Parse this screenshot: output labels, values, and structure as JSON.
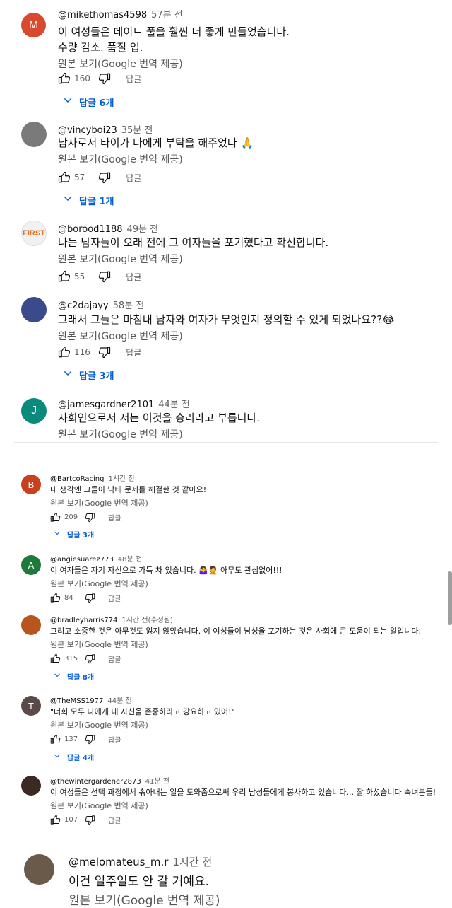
{
  "translate_label": "원본 보기(Google 번역 제공)",
  "reply_label": "답글",
  "comments": [
    {
      "handle": "@mikethomas4598",
      "time": "57분 전",
      "lines": [
        "이 여성들은 데이트 풀을 훨씬 더 좋게 만들었습니다.",
        "수량 감소. 품질 업."
      ],
      "likes": "160",
      "replies": "답글 6개",
      "avatar": "M",
      "avatar_color": "#d84a2f"
    },
    {
      "handle": "@vincyboi23",
      "time": "35분 전",
      "lines": [
        "남자로서 타이가 나에게 부탁을 해주었다 🙏"
      ],
      "likes": "57",
      "replies": "답글 1개",
      "avatar": "",
      "avatar_color": "#7a7a7a"
    },
    {
      "handle": "@borood1188",
      "time": "49분 전",
      "lines": [
        "나는 남자들이 오래 전에 그 여자들을 포기했다고 확신합니다."
      ],
      "likes": "55",
      "replies": "",
      "avatar": "FIRST",
      "avatar_color": "#f1f1f1"
    },
    {
      "handle": "@c2dajayy",
      "time": "58분 전",
      "lines": [
        "그래서 그들은 마침내 남자와 여자가 무엇인지 정의할 수 있게 되었나요??😂"
      ],
      "likes": "116",
      "replies": "답글 3개",
      "avatar": "",
      "avatar_color": "#3a4a8a"
    },
    {
      "handle": "@jamesgardner2101",
      "time": "44분 전",
      "lines": [
        "사회인으로서 저는 이것을 승리라고 부릅니다."
      ],
      "likes": "",
      "replies": "",
      "avatar": "J",
      "avatar_color": "#0a8a7a"
    },
    {
      "handle": "@BartcoRacing",
      "time": "1시간 전",
      "lines": [
        "내 생각엔 그들이 낙태 문제를 해결한 것 같아요!"
      ],
      "likes": "209",
      "replies": "답글 3개",
      "avatar": "B",
      "avatar_color": "#c8401f"
    },
    {
      "handle": "@angiesuarez773",
      "time": "48분 전",
      "lines": [
        "이 여자들은 자기 자신으로 가득 차 있습니다. 🤷‍♀️🤦 아무도 관심없어!!!"
      ],
      "likes": "84",
      "replies": "",
      "avatar": "A",
      "avatar_color": "#1e7a3a"
    },
    {
      "handle": "@bradleyharris774",
      "time": "1시간 전(수정됨)",
      "lines": [
        "그리고 소중한 것은 아무것도 잃지 않았습니다. 이 여성들이 남성을 포기하는 것은 사회에 큰 도움이 되는 일입니다."
      ],
      "likes": "315",
      "replies": "답글 8개",
      "avatar": "",
      "avatar_color": "#b8551e"
    },
    {
      "handle": "@TheMSS1977",
      "time": "44분 전",
      "lines": [
        "\"너희 모두 나에게 내 자신을 존중하라고 강요하고 있어!\""
      ],
      "likes": "137",
      "replies": "답글 4개",
      "avatar": "T",
      "avatar_color": "#5a4a4a"
    },
    {
      "handle": "@thewintergardener2873",
      "time": "41분 전",
      "lines": [
        "이 여성들은 선택 과정에서 솎아내는 일을 도와줌으로써 우리 남성들에게 봉사하고 있습니다... 잘 하셨습니다 숙녀분들!"
      ],
      "likes": "107",
      "replies": "",
      "avatar": "",
      "avatar_color": "#3a2a22"
    },
    {
      "handle": "@melomateus_m.r",
      "time": "1시간 전",
      "lines": [
        "이건 일주일도 안 갈 거예요."
      ],
      "likes": "",
      "replies": "",
      "avatar": "",
      "avatar_color": "#6a5a4a"
    }
  ]
}
